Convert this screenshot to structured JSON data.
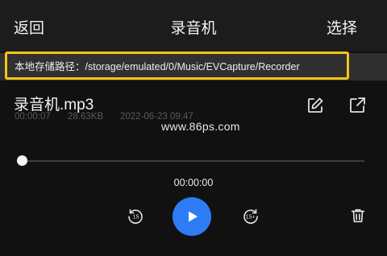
{
  "header": {
    "back_label": "返回",
    "title": "录音机",
    "select_label": "选择"
  },
  "storage_path": {
    "text": "本地存储路径：/storage/emulated/0/Music/EVCapture/Recorder"
  },
  "recording": {
    "name": "录音机.mp3",
    "duration": "00:00:07",
    "size": "28.63KB",
    "date": "2022-06-23 09:47"
  },
  "watermark": "www.86ps.com",
  "player": {
    "current_time": "00:00:00",
    "progress_fraction": 0,
    "rewind_seconds": "15",
    "forward_seconds": "15+"
  },
  "icons": {
    "edit": "edit-icon",
    "share": "share-icon",
    "rewind": "rewind-15-icon",
    "play": "play-icon",
    "forward": "forward-15-icon",
    "delete": "trash-icon"
  },
  "colors": {
    "accent": "#2d7cf6",
    "highlight_border": "#f5c518",
    "background": "#111111"
  }
}
